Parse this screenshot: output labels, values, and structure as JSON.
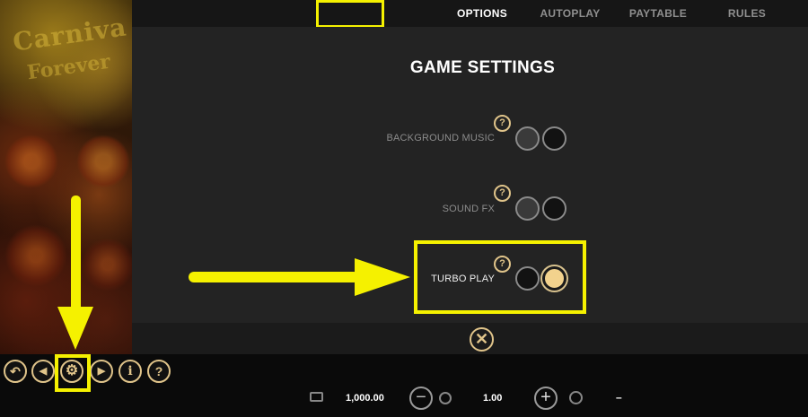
{
  "tabs": {
    "options": "OPTIONS",
    "autoplay": "AUTOPLAY",
    "paytable": "PAYTABLE",
    "rules": "RULES"
  },
  "art": {
    "title_line1": "Carniva",
    "title_line2": "Forever"
  },
  "settings": {
    "title": "GAME SETTINGS",
    "help_glyph": "?",
    "rows": [
      {
        "label": "BACKGROUND MUSIC",
        "state": "off"
      },
      {
        "label": "SOUND FX",
        "state": "off"
      },
      {
        "label": "TURBO PLAY",
        "state": "on"
      }
    ],
    "close_glyph": "✕"
  },
  "controls": {
    "back": "↶",
    "prev": "◀",
    "gear": "⚙",
    "next": "▶",
    "info": "i",
    "help": "?"
  },
  "bottom": {
    "balance": "1,000.00",
    "bet": "1.00",
    "win": "–",
    "minus": "−",
    "plus": "+"
  },
  "colors": {
    "highlight": "#f5f100",
    "accent": "#e0c48a",
    "selected": "#f2d28d"
  }
}
